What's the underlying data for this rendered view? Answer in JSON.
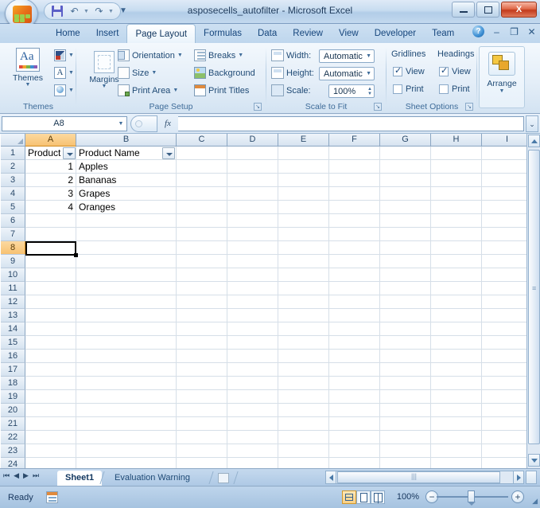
{
  "window": {
    "title": "asposecells_autofilter - Microsoft Excel",
    "quick_access": [
      {
        "name": "save",
        "label": "Save",
        "icon": "save-icon"
      },
      {
        "name": "undo",
        "label": "Undo",
        "icon": "undo-icon"
      },
      {
        "name": "redo",
        "label": "Redo",
        "icon": "redo-icon"
      },
      {
        "name": "customize",
        "label": "Customize Quick Access Toolbar",
        "icon": "chevron-down-icon"
      }
    ],
    "controls": {
      "minimize": "–",
      "maximize": "□",
      "close": "X"
    }
  },
  "ribbon": {
    "tabs": [
      {
        "label": "Home",
        "active": false
      },
      {
        "label": "Insert",
        "active": false
      },
      {
        "label": "Page Layout",
        "active": true
      },
      {
        "label": "Formulas",
        "active": false
      },
      {
        "label": "Data",
        "active": false
      },
      {
        "label": "Review",
        "active": false
      },
      {
        "label": "View",
        "active": false
      },
      {
        "label": "Developer",
        "active": false
      },
      {
        "label": "Team",
        "active": false
      }
    ],
    "right_controls": {
      "help": "?",
      "minimize_ribbon": "–",
      "restore": "❐",
      "close": "X"
    },
    "groups": {
      "themes": {
        "label": "Themes",
        "main_button": "Themes",
        "items": [
          {
            "label": "Colors",
            "icon": "theme-colors-icon"
          },
          {
            "label": "Fonts",
            "icon": "theme-fonts-icon"
          },
          {
            "label": "Effects",
            "icon": "theme-effects-icon"
          }
        ]
      },
      "page_setup": {
        "label": "Page Setup",
        "main_button": "Margins",
        "items": [
          {
            "label": "Orientation",
            "icon": "orientation-icon"
          },
          {
            "label": "Size",
            "icon": "size-icon"
          },
          {
            "label": "Print Area",
            "icon": "print-area-icon"
          },
          {
            "label": "Breaks",
            "icon": "breaks-icon"
          },
          {
            "label": "Background",
            "icon": "background-icon"
          },
          {
            "label": "Print Titles",
            "icon": "print-titles-icon"
          }
        ]
      },
      "scale_to_fit": {
        "label": "Scale to Fit",
        "width_label": "Width:",
        "width_value": "Automatic",
        "height_label": "Height:",
        "height_value": "Automatic",
        "scale_label": "Scale:",
        "scale_value": "100%"
      },
      "sheet_options": {
        "label": "Sheet Options",
        "columns": [
          "Gridlines",
          "Headings"
        ],
        "gridlines_view": {
          "label": "View",
          "checked": true
        },
        "gridlines_print": {
          "label": "Print",
          "checked": false
        },
        "headings_view": {
          "label": "View",
          "checked": true
        },
        "headings_print": {
          "label": "Print",
          "checked": false
        }
      },
      "arrange": {
        "label": "Arrange",
        "main_button": "Arrange"
      }
    }
  },
  "formula_bar": {
    "name_box": "A8",
    "fx_label": "fx",
    "formula_value": "",
    "expand_icon": "chevron-double-down-icon"
  },
  "grid": {
    "column_headers": [
      "A",
      "B",
      "C",
      "D",
      "E",
      "F",
      "G",
      "H",
      "I"
    ],
    "selected_column": "A",
    "row_headers": [
      1,
      2,
      3,
      4,
      5,
      6,
      7,
      8,
      9,
      10,
      11,
      12,
      13,
      14,
      15,
      16,
      17,
      18,
      19,
      20,
      21,
      22,
      23,
      24
    ],
    "selected_row": 8,
    "selected_cell": "A8",
    "cells": [
      {
        "row": 1,
        "col": "A",
        "value": "Product",
        "align": "left",
        "filter": true
      },
      {
        "row": 1,
        "col": "B",
        "value": "Product Name",
        "align": "left",
        "filter": true
      },
      {
        "row": 2,
        "col": "A",
        "value": "1",
        "align": "right"
      },
      {
        "row": 2,
        "col": "B",
        "value": "Apples",
        "align": "left"
      },
      {
        "row": 3,
        "col": "A",
        "value": "2",
        "align": "right"
      },
      {
        "row": 3,
        "col": "B",
        "value": "Bananas",
        "align": "left"
      },
      {
        "row": 4,
        "col": "A",
        "value": "3",
        "align": "right"
      },
      {
        "row": 4,
        "col": "B",
        "value": "Grapes",
        "align": "left"
      },
      {
        "row": 5,
        "col": "A",
        "value": "4",
        "align": "right"
      },
      {
        "row": 5,
        "col": "B",
        "value": "Oranges",
        "align": "left"
      }
    ]
  },
  "sheet_tabs": {
    "nav": [
      "⏮",
      "◀",
      "▶",
      "⏭"
    ],
    "tabs": [
      {
        "label": "Sheet1",
        "active": true
      },
      {
        "label": "Evaluation Warning",
        "active": false
      }
    ],
    "insert_sheet_icon": "insert-worksheet-icon"
  },
  "status_bar": {
    "status": "Ready",
    "macro_icon": "record-macro-icon",
    "views": [
      {
        "name": "normal",
        "label": "Normal",
        "active": true
      },
      {
        "name": "page-layout",
        "label": "Page Layout",
        "active": false
      },
      {
        "name": "page-break-preview",
        "label": "Page Break Preview",
        "active": false
      }
    ],
    "zoom": "100%",
    "zoom_out": "−",
    "zoom_in": "+"
  }
}
